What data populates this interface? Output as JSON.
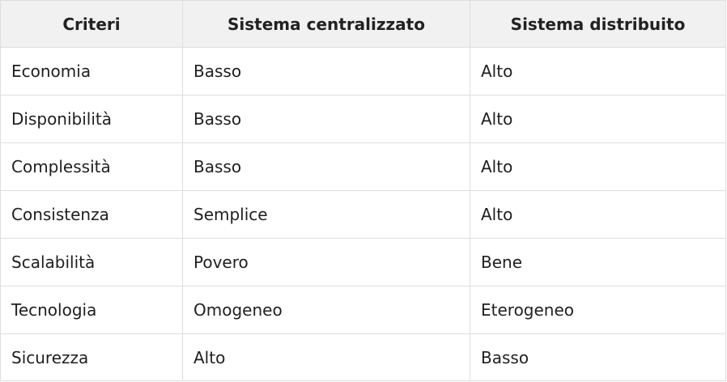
{
  "table": {
    "headers": [
      "Criteri",
      "Sistema centralizzato",
      "Sistema distribuito"
    ],
    "rows": [
      [
        "Economia",
        "Basso",
        "Alto"
      ],
      [
        "Disponibilità",
        "Basso",
        "Alto"
      ],
      [
        "Complessità",
        "Basso",
        "Alto"
      ],
      [
        "Consistenza",
        "Semplice",
        "Alto"
      ],
      [
        "Scalabilità",
        "Povero",
        "Bene"
      ],
      [
        "Tecnologia",
        "Omogeneo",
        "Eterogeneo"
      ],
      [
        "Sicurezza",
        "Alto",
        "Basso"
      ]
    ]
  },
  "colors": {
    "header_background": "#f1f1f1",
    "border": "#dedede",
    "text": "#1f1f1f"
  }
}
